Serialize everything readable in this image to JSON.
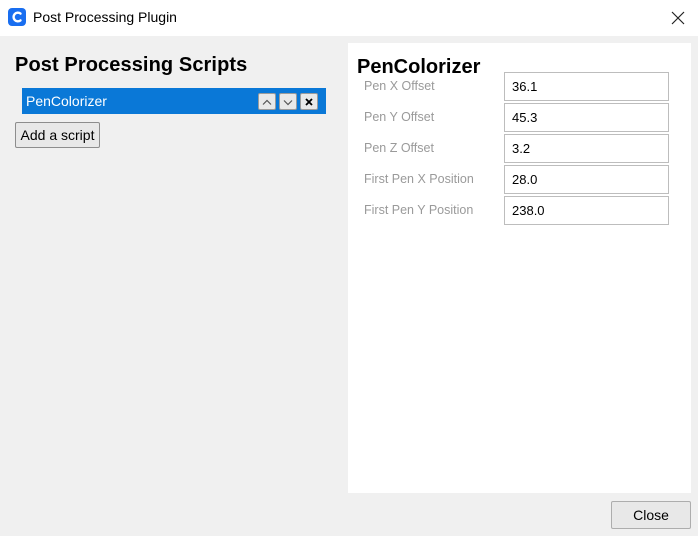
{
  "window": {
    "title": "Post Processing Plugin",
    "app_icon": "cura-logo-icon",
    "close_icon": "close-icon"
  },
  "left": {
    "heading": "Post Processing Scripts",
    "scripts": [
      {
        "label": "PenColorizer",
        "selected": true
      }
    ],
    "item_buttons": [
      "move-up-icon",
      "move-down-icon",
      "remove-icon"
    ],
    "add_label": "Add a script"
  },
  "right": {
    "heading": "PenColorizer",
    "settings": [
      {
        "label": "Pen X Offset",
        "value": "36.1"
      },
      {
        "label": "Pen Y Offset",
        "value": "45.3"
      },
      {
        "label": "Pen Z Offset",
        "value": "3.2"
      },
      {
        "label": "First Pen X Position",
        "value": "28.0"
      },
      {
        "label": "First Pen Y Position",
        "value": "238.0"
      }
    ]
  },
  "footer": {
    "close_label": "Close"
  },
  "colors": {
    "selection": "#0a78d7",
    "app_icon": "#196ef0",
    "label_gray": "#9a9a9a"
  }
}
